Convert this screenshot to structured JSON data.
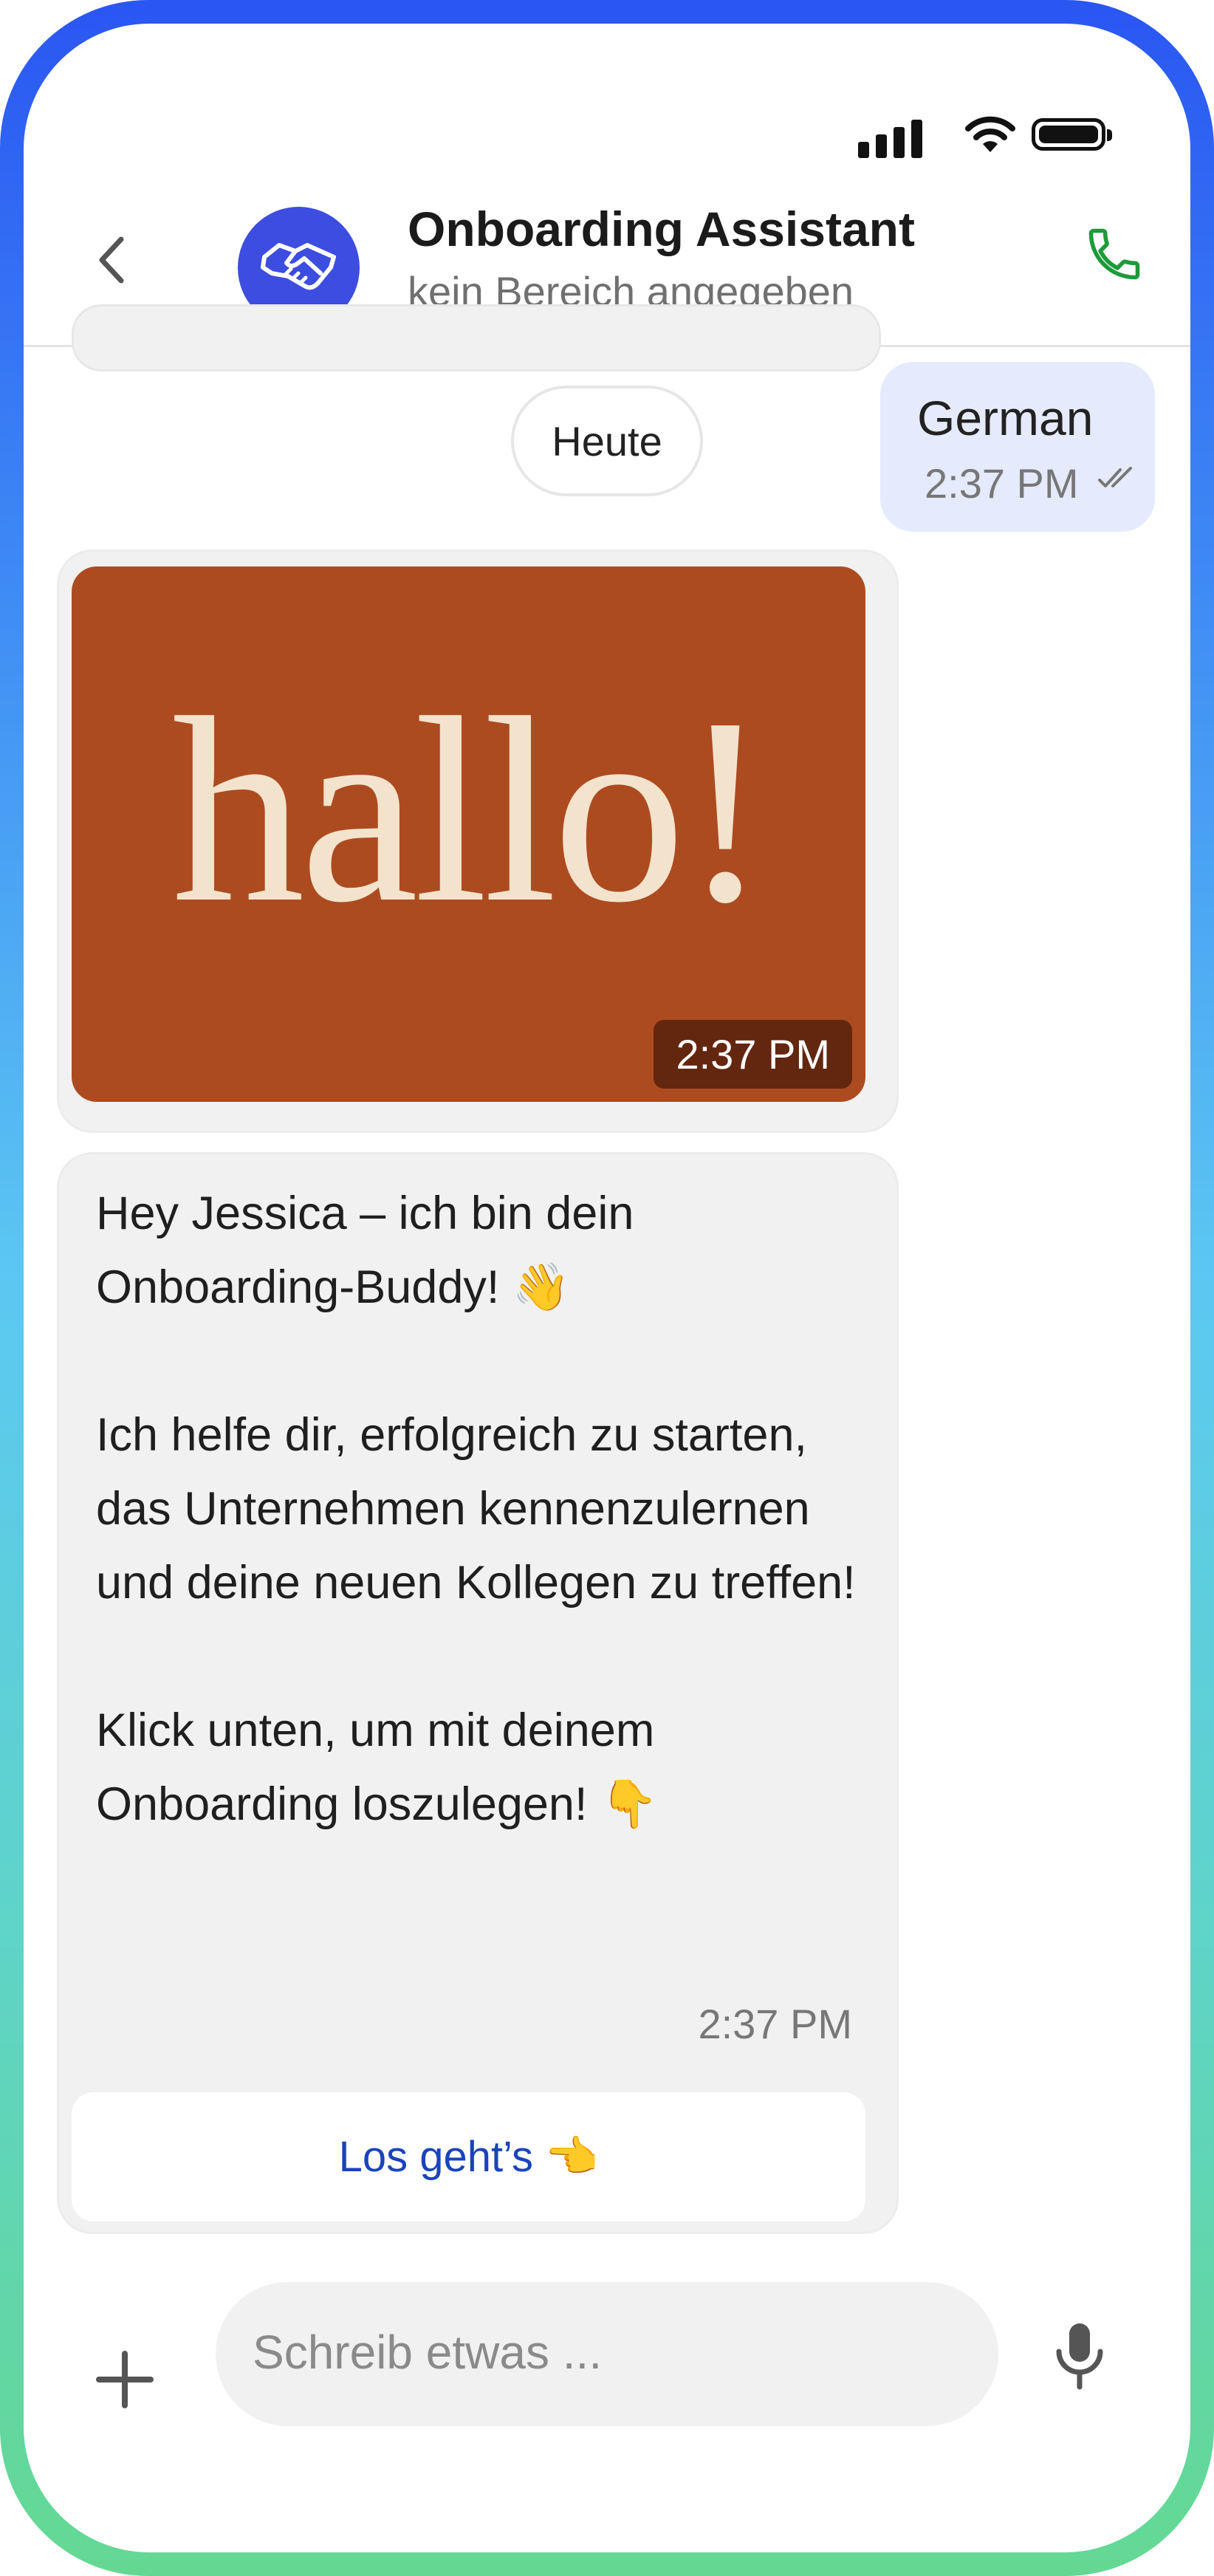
{
  "header": {
    "title": "Onboarding Assistant",
    "subtitle": "kein Bereich angegeben"
  },
  "chat": {
    "date_separator": "Heute",
    "outgoing": {
      "text": "German",
      "time": "2:37 PM",
      "status": "read"
    },
    "image_message": {
      "image_text": "hallo!",
      "time": "2:37 PM"
    },
    "text_message": {
      "text": "Hey Jessica – ich bin dein Onboarding-Buddy! 👋\n\nIch helfe dir, erfolgreich zu starten, das Unternehmen kennenzulernen und deine neuen Kollegen zu treffen!\n\nKlick unten, um mit deinem Onboarding loszulegen! 👇",
      "time": "2:37 PM",
      "button_label": "Los geht’s 👈"
    }
  },
  "composer": {
    "placeholder": "Schreib etwas ..."
  },
  "colors": {
    "avatar_bg": "#3c4de0",
    "outgoing_bubble": "#e5ebfd",
    "image_bg": "#ad4b20",
    "link": "#1a44b8",
    "call_icon": "#1e9a3a"
  },
  "icons": [
    "signal-icon",
    "wifi-icon",
    "battery-icon",
    "back-icon",
    "handshake-icon",
    "phone-icon",
    "read-receipt-icon",
    "plus-icon",
    "microphone-icon"
  ]
}
